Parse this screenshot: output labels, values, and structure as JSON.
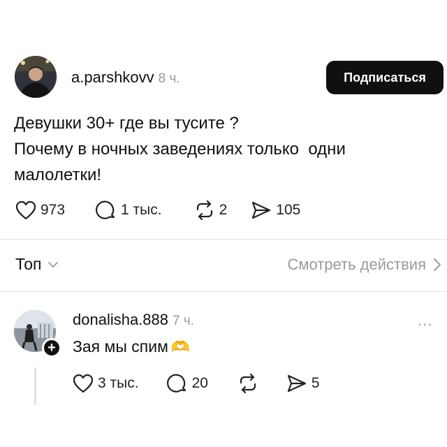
{
  "post": {
    "author": "a.parshkovv",
    "time": "8 ч.",
    "follow_label": "Подписаться",
    "text_lines": [
      "Девушки 30+ где вы тусите ?",
      "Почему в ночных заведениях только  одни",
      "малолетки!"
    ],
    "likes": "973",
    "comments": "1 тыс.",
    "reposts": "2",
    "shares": "105"
  },
  "sort": {
    "label": "Топ"
  },
  "activity_link": {
    "label": "Смотреть действия"
  },
  "reply": {
    "author": "donalisha.888",
    "time": "7 ч.",
    "more": "...",
    "text": "Зая мы спим",
    "emoji": "🫶",
    "likes": "3 тыс.",
    "comments": "20",
    "shares": "5"
  },
  "icons": {
    "like": "heart-icon",
    "comment": "speech-bubble-icon",
    "repost": "repost-arrows-icon",
    "share": "paper-plane-icon",
    "sort": "chevron-down-icon",
    "activity": "chevron-right-icon",
    "add": "plus-icon",
    "emoji": "heart-hands-icon"
  },
  "colors": {
    "text": "#101010",
    "muted": "#9a9a9a",
    "button_bg": "#101010",
    "divider": "#e4e4e4"
  }
}
